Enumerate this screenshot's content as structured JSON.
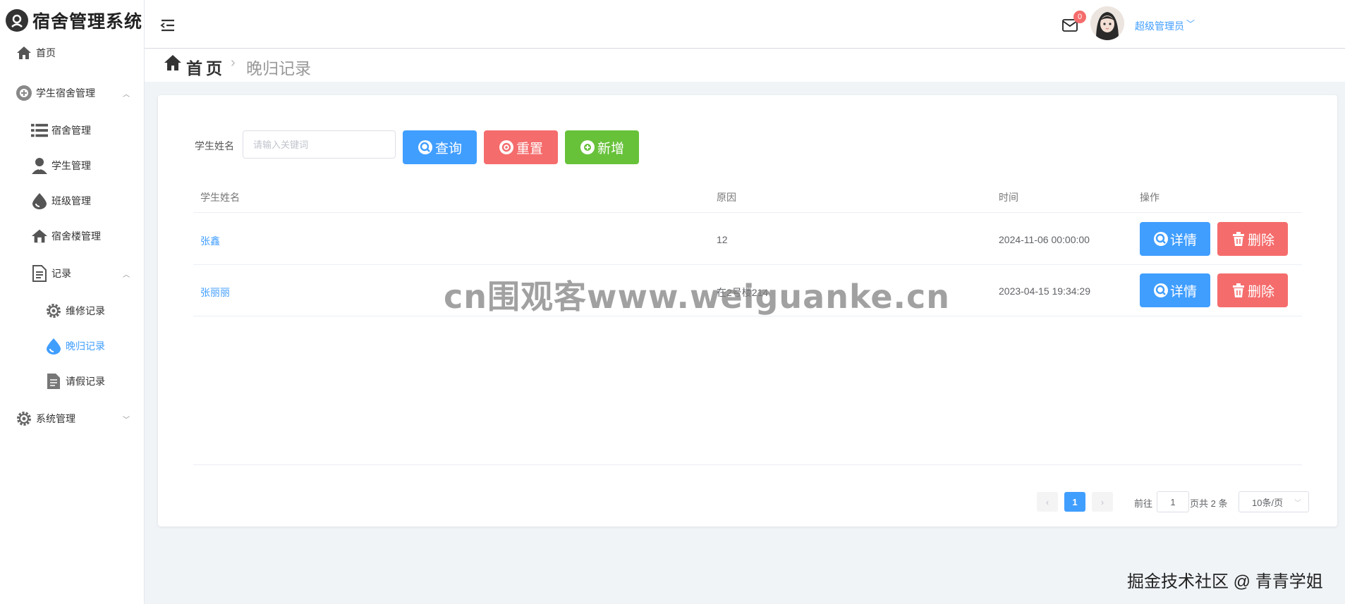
{
  "app": {
    "title": "宿舍管理系统"
  },
  "sidebar": {
    "home": "首页",
    "student_dorm": "学生宿舍管理",
    "dorm_manage": "宿舍管理",
    "student_manage": "学生管理",
    "class_manage": "班级管理",
    "building_manage": "宿舍楼管理",
    "records": "记录",
    "repair_records": "维修记录",
    "late_records": "晚归记录",
    "leave_records": "请假记录",
    "system_manage": "系统管理"
  },
  "header": {
    "mail_count": "0",
    "user_name": "超级管理员"
  },
  "breadcrumb": {
    "home": "首页",
    "current": "晚归记录"
  },
  "search": {
    "label": "学生姓名",
    "placeholder": "请输入关键词",
    "query_label": "查询",
    "reset_label": "重置",
    "add_label": "新增"
  },
  "table": {
    "headers": [
      "学生姓名",
      "原因",
      "时间",
      "操作"
    ],
    "rows": [
      {
        "name": "张鑫",
        "reason": "12",
        "time": "2024-11-06 00:00:00",
        "detail": "详情",
        "delete": "删除"
      },
      {
        "name": "张丽丽",
        "reason": "在2号楼214",
        "time": "2023-04-15 19:34:29",
        "detail": "详情",
        "delete": "删除"
      }
    ]
  },
  "pagination": {
    "prev": "‹",
    "current_page": "1",
    "next": "›",
    "goto_label": "前往",
    "goto_value": "1",
    "total_label": "页共 2 条",
    "page_size": "10条/页"
  },
  "overlays": {
    "watermark": "cn围观客www.weiguanke.cn",
    "footer": "掘金技术社区 @ 青青学姐"
  },
  "colors": {
    "primary": "#409eff",
    "danger": "#f56c6c",
    "success": "#67c23a"
  }
}
